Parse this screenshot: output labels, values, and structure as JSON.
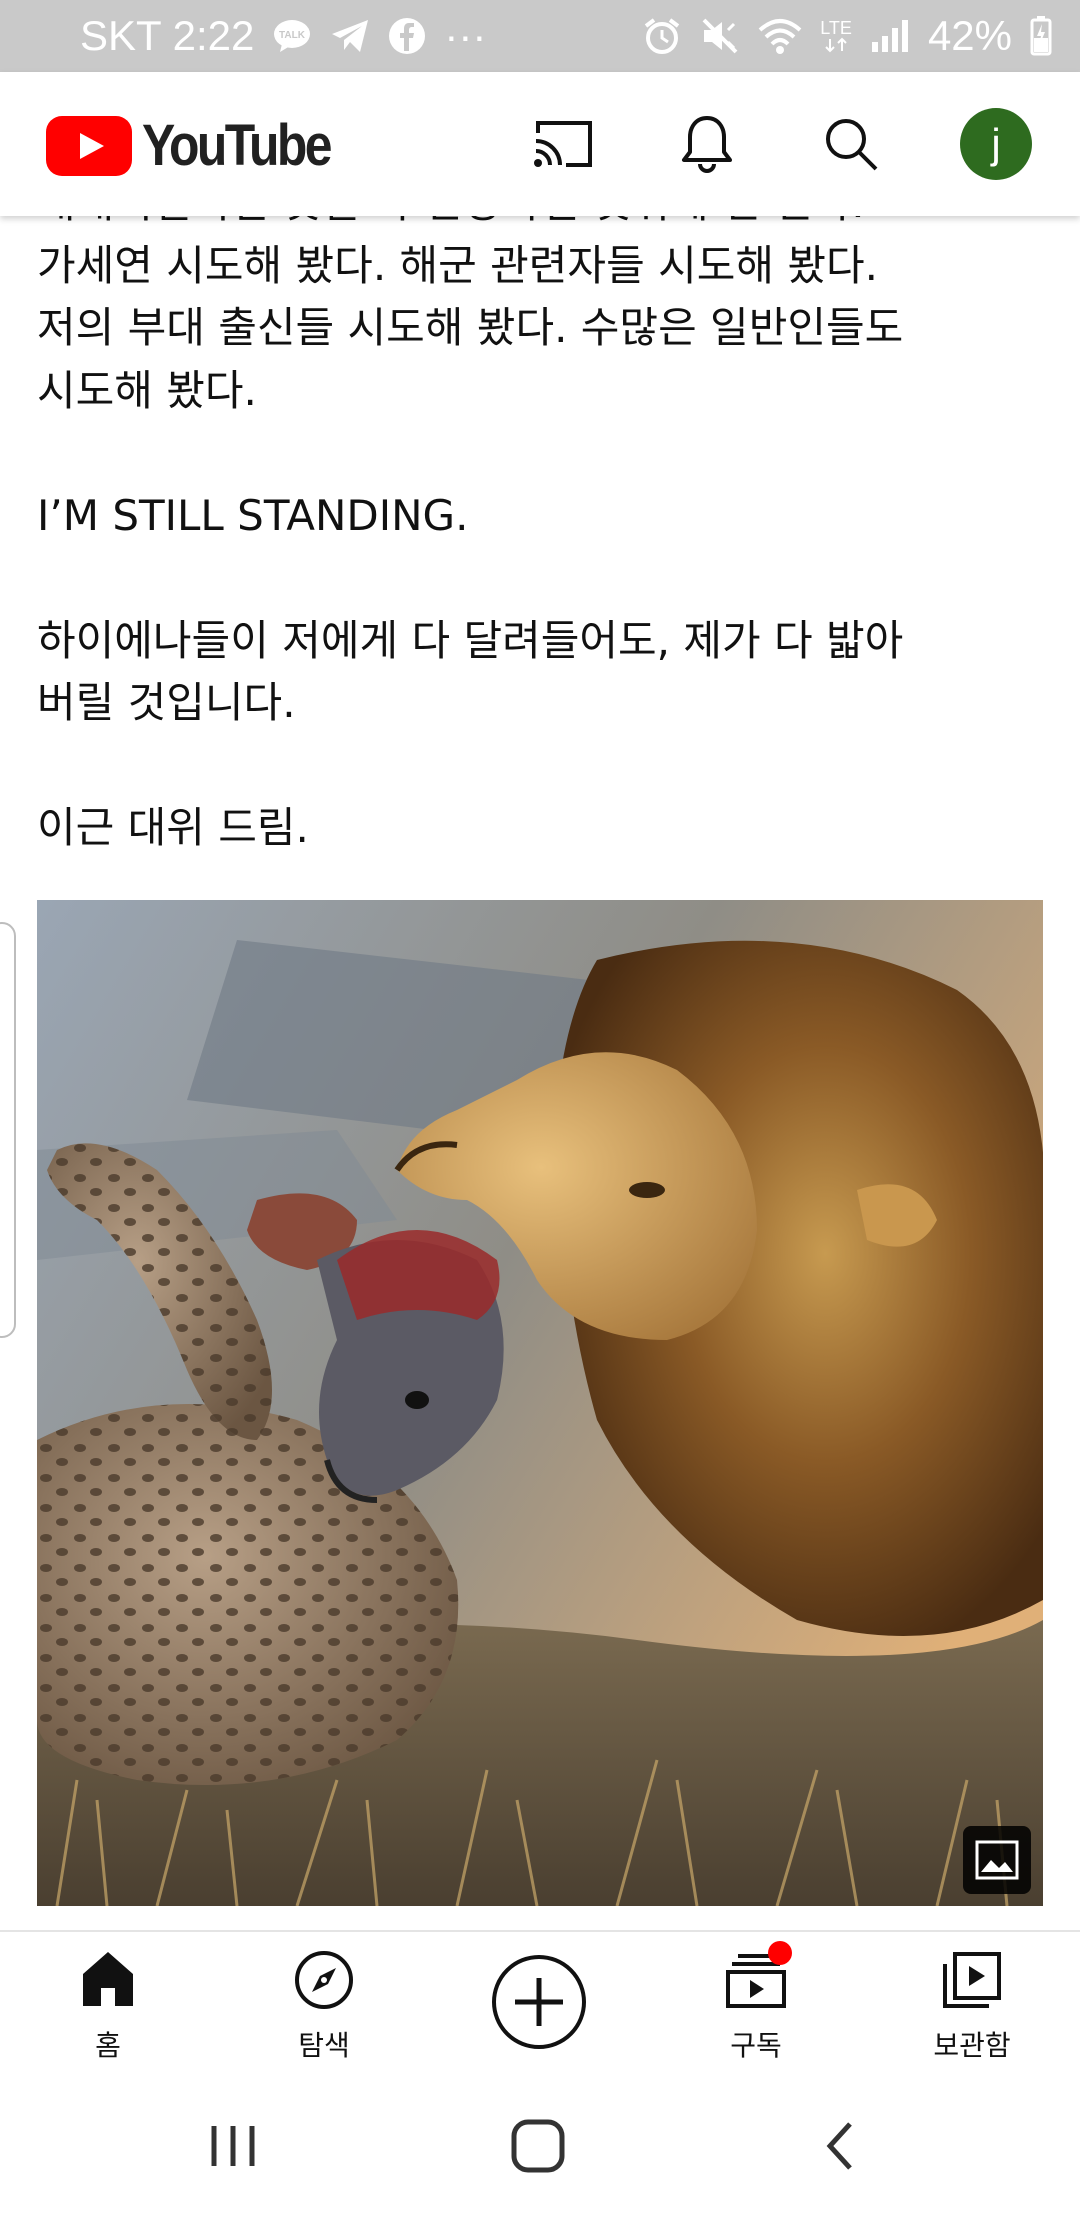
{
  "status_bar": {
    "carrier_time": "SKT 2:22",
    "more": "···",
    "network": "LTE",
    "battery": "42%"
  },
  "app_bar": {
    "logo_text": "YouTube",
    "avatar_letter": "j",
    "brand_color": "#ff0000",
    "avatar_color": "#2e6b1f"
  },
  "post": {
    "lines": [
      "대대적일이던 것일 다 판당하던 것뒤에 턴 된다.",
      "가세연 시도해 봤다. 해군 관련자들 시도해 봤다.",
      "저의 부대 출신들 시도해 봤다. 수많은 일반인들도",
      "시도해 봤다.",
      "",
      "I’M STILL STANDING.",
      "",
      "하이에나들이 저에게 다 달려들어도, 제가 다 밟아",
      "버릴 것입니다.",
      "",
      "이근 대위 드림."
    ],
    "image_icon": "image-icon"
  },
  "bottom_nav": {
    "home": "홈",
    "explore": "탐색",
    "subscriptions": "구독",
    "library": "보관함",
    "notification_dot_color": "#ff0000"
  }
}
